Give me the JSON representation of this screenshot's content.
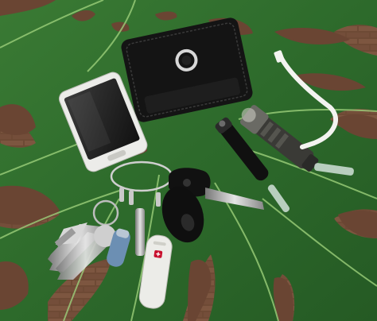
{
  "scene": {
    "description_items": [
      {
        "name": "smartphone"
      },
      {
        "name": "leather-wallet"
      },
      {
        "name": "flashlight-large"
      },
      {
        "name": "flashlight-small"
      },
      {
        "name": "car-key-fob"
      },
      {
        "name": "key-ring-with-keys"
      },
      {
        "name": "swiss-army-knife"
      },
      {
        "name": "monstera-leaf"
      },
      {
        "name": "brick-ground"
      }
    ],
    "colors": {
      "ground": "#6b4a36",
      "leaf": "#2f6e2e",
      "leaf_vein": "#9ccf7a",
      "wallet": "#151515",
      "phone_body": "#e9e9e6",
      "knife": "#e8e8e4"
    }
  }
}
